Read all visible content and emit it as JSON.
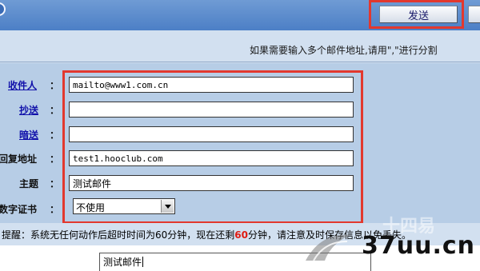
{
  "toolbar": {
    "send_label": "发送"
  },
  "hint": {
    "text": "如果需要输入多个邮件地址,请用\",\"进行分割"
  },
  "form": {
    "to": {
      "label": "收件人",
      "value": "mailto@www1.com.cn"
    },
    "cc": {
      "label": "抄送",
      "value": ""
    },
    "bcc": {
      "label": "暗送",
      "value": ""
    },
    "reply": {
      "label": "回复地址",
      "value": "test1.hooclub.com"
    },
    "subject": {
      "label": "主题",
      "value": "测试邮件"
    },
    "cert": {
      "label": "数字证书",
      "selected": "不使用"
    },
    "colon": "："
  },
  "notice": {
    "prefix": "提醒：系统无任何动作后超时时间为60分钟，现在还剩",
    "remaining": "60",
    "suffix": "分钟，请注意及时保存信息以免丢失。"
  },
  "editor": {
    "subject_echo": "测试邮件"
  },
  "watermark": {
    "text": "37uu.cn",
    "faint": "十四易"
  },
  "colors": {
    "highlight": "#e2382e",
    "link": "#1111aa",
    "countdown": "#e01b12"
  }
}
